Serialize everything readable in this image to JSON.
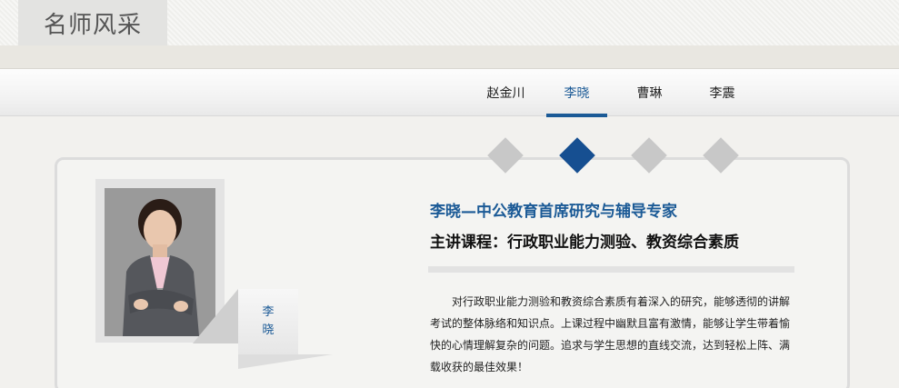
{
  "header": {
    "title": "名师风采"
  },
  "tabs": [
    {
      "label": "赵金川",
      "active": false
    },
    {
      "label": "李晓",
      "active": true
    },
    {
      "label": "曹琳",
      "active": false
    },
    {
      "label": "李震",
      "active": false
    }
  ],
  "accent_color": "#1b5a96",
  "profile": {
    "name_char_1": "李",
    "name_char_2": "晓",
    "headline": "李晓—中公教育首席研究与辅导专家",
    "courses": "主讲课程：行政职业能力测验、教资综合素质",
    "description": "对行政职业能力测验和教资综合素质有着深入的研究，能够透彻的讲解考试的整体脉络和知识点。上课过程中幽默且富有激情，能够让学生带着愉快的心情理解复杂的问题。追求与学生思想的直线交流，达到轻松上阵、满载收获的最佳效果！"
  }
}
